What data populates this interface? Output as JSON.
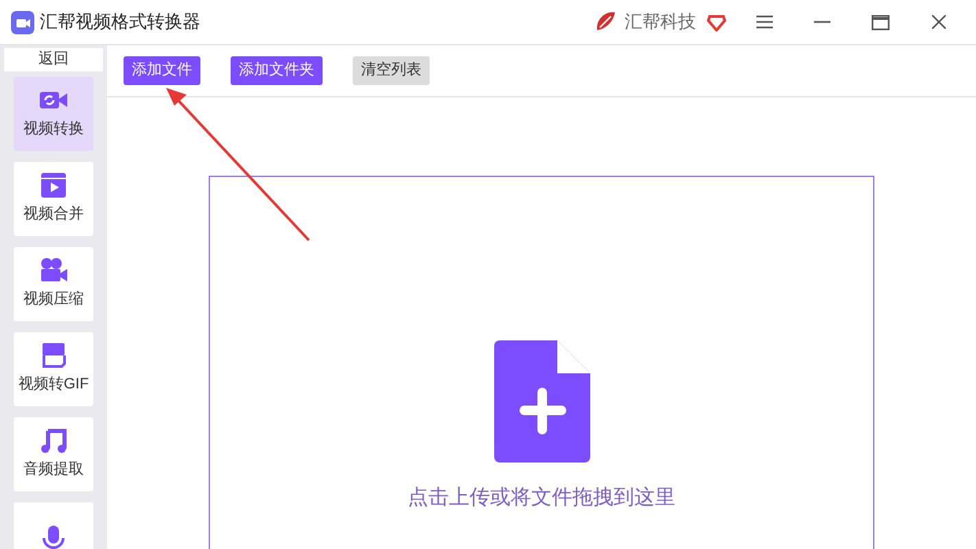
{
  "window": {
    "title": "汇帮视频格式转换器",
    "brand": "汇帮科技"
  },
  "sidebar": {
    "back": "返回",
    "items": [
      {
        "kind": "convert",
        "label": "视频转换",
        "selected": true
      },
      {
        "kind": "merge",
        "label": "视频合并",
        "selected": false
      },
      {
        "kind": "compress",
        "label": "视频压缩",
        "selected": false
      },
      {
        "kind": "gif",
        "label": "视频转GIF",
        "selected": false
      },
      {
        "kind": "audio",
        "label": "音频提取",
        "selected": false
      },
      {
        "kind": "mic",
        "selected": false
      }
    ]
  },
  "toolbar": [
    {
      "kind": "primary",
      "label": "添加文件"
    },
    {
      "kind": "primary",
      "label": "添加文件夹"
    },
    {
      "kind": "secondary",
      "label": "清空列表"
    }
  ],
  "dropzone": {
    "hint": "点击上传或将文件拖拽到这里"
  }
}
